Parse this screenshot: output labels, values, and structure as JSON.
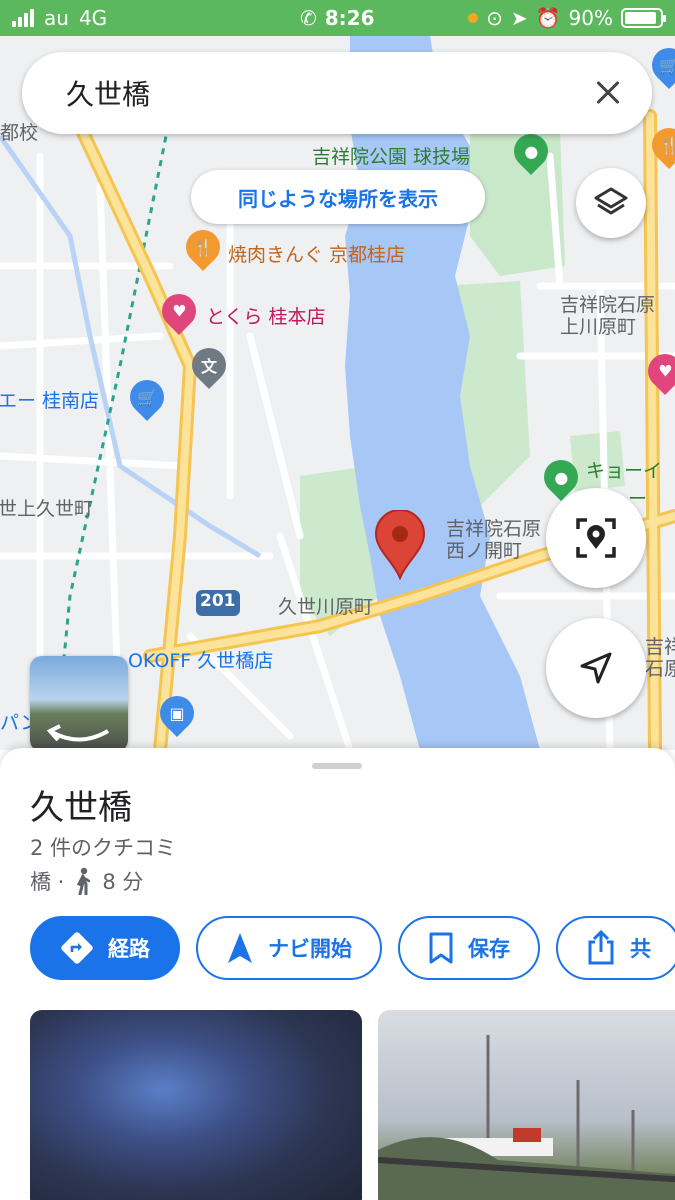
{
  "status_bar": {
    "carrier": "au",
    "network": "4G",
    "time": "8:26",
    "battery_percent": "90%",
    "battery_level": 0.9,
    "colors": {
      "background": "#5cb85c"
    }
  },
  "search": {
    "query": "久世橋",
    "clear_icon": "close-icon"
  },
  "map": {
    "similar_places_chip": "同じような場所を表示",
    "labels": {
      "park": "吉祥院公園 球技場",
      "restaurant_yakiniku": "焼肉きんぐ 京都桂店",
      "tokura": "とくら 桂本店",
      "store_left": "エー 桂南店",
      "area_kissyoin_kamikawara": "吉祥院石原\n上川原町",
      "area_kuze": "世上久世町",
      "area_nishinokai": "吉祥院石原\n西ノ開町",
      "area_kuzekawara": "久世川原町",
      "route_number": "201",
      "bookoff": "OKOFF 久世橋店",
      "pan": "パン 京都南店",
      "kyoei": "キョーイ",
      "community": "ミュー",
      "edge_top_left": "都校",
      "edge_bottom_right": "吉祥\n石原",
      "school_symbol": "文"
    },
    "colors": {
      "water": "#a7c7f7",
      "road_major": "#f7d675",
      "land": "#eef0f2",
      "park": "#c9e7c9",
      "pin_red": "#db4437"
    }
  },
  "place": {
    "name": "久世橋",
    "reviews": "2 件のクチコミ",
    "category": "橋 ·",
    "walk_time": "8 分"
  },
  "actions": [
    {
      "label": "経路",
      "icon": "directions-icon"
    },
    {
      "label": "ナビ開始",
      "icon": "navigation-arrow-icon"
    },
    {
      "label": "保存",
      "icon": "bookmark-icon"
    },
    {
      "label": "共",
      "icon": "share-icon"
    }
  ]
}
